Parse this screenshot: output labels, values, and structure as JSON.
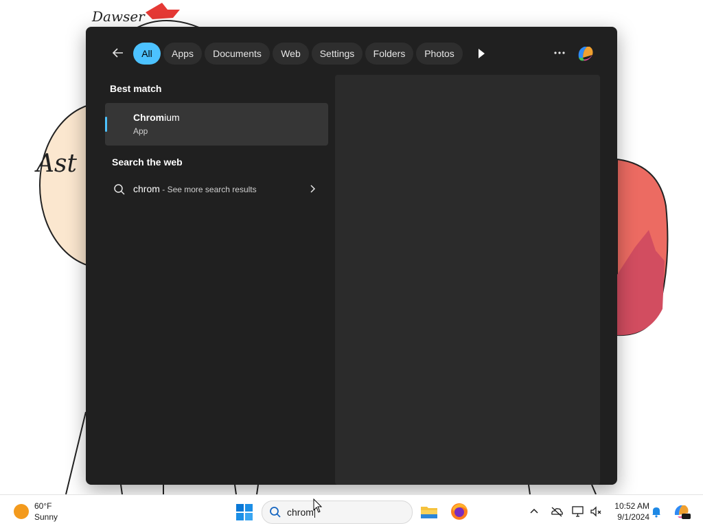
{
  "wallpaper": {
    "signature": "Dawser",
    "partial_text": "Ast"
  },
  "search_panel": {
    "filters": [
      {
        "label": "All",
        "active": true
      },
      {
        "label": "Apps",
        "active": false
      },
      {
        "label": "Documents",
        "active": false
      },
      {
        "label": "Web",
        "active": false
      },
      {
        "label": "Settings",
        "active": false
      },
      {
        "label": "Folders",
        "active": false
      },
      {
        "label": "Photos",
        "active": false
      }
    ],
    "best_match": {
      "heading": "Best match",
      "app_name_bold": "Chrom",
      "app_name_rest": "ium",
      "app_type": "App"
    },
    "search_web": {
      "heading": "Search the web",
      "query": "chrom",
      "suffix": " - See more search results"
    },
    "icons": [
      "back-arrow-icon",
      "play-icon",
      "more-options-icon",
      "copilot-icon"
    ]
  },
  "taskbar": {
    "weather": {
      "temp": "60°F",
      "condition": "Sunny"
    },
    "search_value": "chrom",
    "apps": [
      "windows-start-icon",
      "file-explorer-icon",
      "firefox-icon"
    ],
    "tray_icons": [
      "chevron-up-icon",
      "onedrive-offline-icon",
      "display-icon",
      "audio-muted-icon",
      "notification-bell-icon",
      "copilot-pre-icon"
    ],
    "clock": {
      "time": "10:52 AM",
      "date": "9/1/2024"
    }
  },
  "colors": {
    "panel_bg": "#202020",
    "accent": "#4cc2ff",
    "chip_bg": "#2e2e2e",
    "preview_bg": "#2b2b2b"
  }
}
